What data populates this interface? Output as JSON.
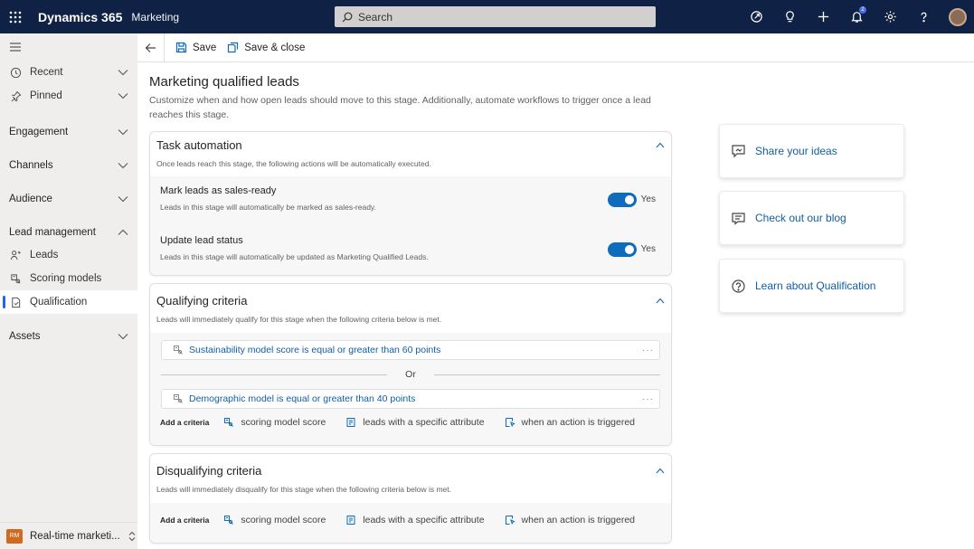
{
  "topbar": {
    "app_name": "Dynamics 365",
    "module_name": "Marketing",
    "search_placeholder": "Search",
    "icons": [
      "assist-icon",
      "lightbulb-icon",
      "add-icon",
      "notifications-icon",
      "settings-icon",
      "help-icon",
      "avatar"
    ],
    "notification_count": "2",
    "bg_color": "#0f2245"
  },
  "sidebar": {
    "recent": "Recent",
    "pinned": "Pinned",
    "groups": {
      "engagement": "Engagement",
      "channels": "Channels",
      "audience": "Audience",
      "lead_management": "Lead management",
      "assets": "Assets"
    },
    "lead_items": [
      "Leads",
      "Scoring models",
      "Qualification"
    ],
    "active_item": "Qualification",
    "area": {
      "badge": "RM",
      "label": "Real-time marketi..."
    }
  },
  "commandbar": {
    "save": "Save",
    "save_close": "Save & close"
  },
  "page": {
    "title": "Marketing qualified leads",
    "description": "Customize when and how open leads should move to this stage. Additionally, automate workflows to trigger once a lead reaches this stage."
  },
  "task_automation": {
    "title": "Task automation",
    "subtitle": "Once leads reach this stage, the following actions will be automatically executed.",
    "rows": [
      {
        "title": "Mark leads as sales-ready",
        "desc": "Leads in this stage will automatically be marked as sales-ready.",
        "value": "Yes",
        "on": true
      },
      {
        "title": "Update lead status",
        "desc": "Leads in this stage will automatically be updated as Marketing Qualified Leads.",
        "value": "Yes",
        "on": true
      }
    ]
  },
  "qualifying": {
    "title": "Qualifying criteria",
    "subtitle": "Leads will immediately qualify for this stage when the following criteria below is met.",
    "criteria": [
      "Sustainability model score is equal or greater than 60 points",
      "Demographic model is equal or greater than 40 points"
    ],
    "or_label": "Or",
    "more": "···"
  },
  "disqualifying": {
    "title": "Disqualifying criteria",
    "subtitle": "Leads will immediately disqualify for this stage when the following criteria below is met."
  },
  "add_criteria": {
    "label": "Add a criteria",
    "options": [
      "scoring model score",
      "leads with a specific attribute",
      "when an action is triggered"
    ]
  },
  "side_cards": [
    "Share your ideas",
    "Check out our blog",
    "Learn about Qualification"
  ],
  "colors": {
    "accent": "#0f6cbd",
    "link": "#115ea3",
    "area_badge": "#d2691e"
  }
}
